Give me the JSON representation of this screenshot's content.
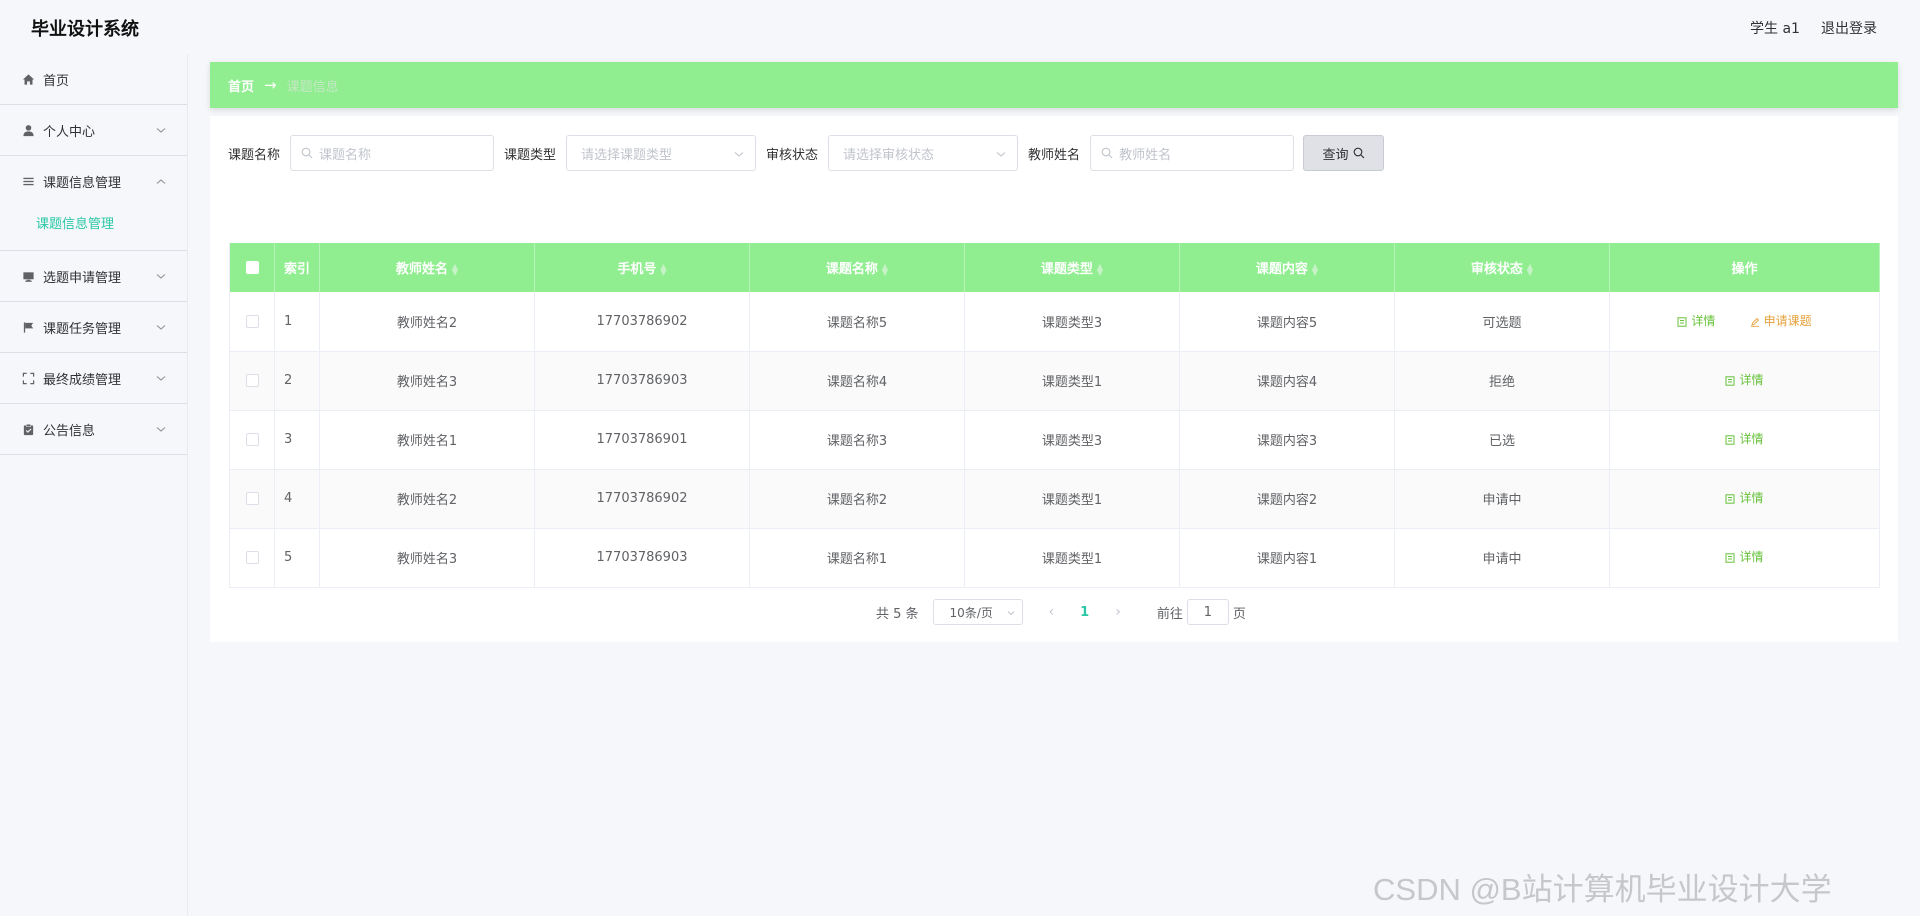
{
  "app": {
    "title": "毕业设计系统"
  },
  "header": {
    "user_label": "学生 a1",
    "logout_label": "退出登录"
  },
  "sidebar": {
    "items": [
      {
        "label": "首页",
        "icon": "home-icon"
      },
      {
        "label": "个人中心",
        "icon": "user-icon"
      },
      {
        "label": "课题信息管理",
        "icon": "list-icon",
        "sub": "课题信息管理"
      },
      {
        "label": "选题申请管理",
        "icon": "monitor-icon"
      },
      {
        "label": "课题任务管理",
        "icon": "flag-icon"
      },
      {
        "label": "最终成绩管理",
        "icon": "fullscreen-icon"
      },
      {
        "label": "公告信息",
        "icon": "clipboard-icon"
      }
    ],
    "active_color": "#2cc8a6"
  },
  "breadcrumb": {
    "home": "首页",
    "current": "课题信息"
  },
  "search": {
    "name_label": "课题名称",
    "name_placeholder": "课题名称",
    "type_label": "课题类型",
    "type_placeholder": "请选择课题类型",
    "status_label": "审核状态",
    "status_placeholder": "请选择审核状态",
    "teacher_label": "教师姓名",
    "teacher_placeholder": "教师姓名",
    "query_label": "查询"
  },
  "table": {
    "headers": [
      "索引",
      "教师姓名",
      "手机号",
      "课题名称",
      "课题类型",
      "课题内容",
      "审核状态",
      "操作"
    ],
    "rows": [
      {
        "index": "1",
        "teacher": "教师姓名2",
        "phone": "17703786902",
        "name": "课题名称5",
        "type": "课题类型3",
        "content": "课题内容5",
        "status": "可选题"
      },
      {
        "index": "2",
        "teacher": "教师姓名3",
        "phone": "17703786903",
        "name": "课题名称4",
        "type": "课题类型1",
        "content": "课题内容4",
        "status": "拒绝"
      },
      {
        "index": "3",
        "teacher": "教师姓名1",
        "phone": "17703786901",
        "name": "课题名称3",
        "type": "课题类型3",
        "content": "课题内容3",
        "status": "已选"
      },
      {
        "index": "4",
        "teacher": "教师姓名2",
        "phone": "17703786902",
        "name": "课题名称2",
        "type": "课题类型1",
        "content": "课题内容2",
        "status": "申请中"
      },
      {
        "index": "5",
        "teacher": "教师姓名3",
        "phone": "17703786903",
        "name": "课题名称1",
        "type": "课题类型1",
        "content": "课题内容1",
        "status": "申请中"
      }
    ],
    "detail_label": "详情",
    "apply_label": "申请课题",
    "header_bg": "#90ee90"
  },
  "pagination": {
    "total_text": "共 5 条",
    "page_size": "10条/页",
    "current_page": "1",
    "goto_label": "前往",
    "goto_value": "1",
    "page_suffix": "页"
  },
  "watermark": "CSDN @B站计算机毕业设计大学"
}
